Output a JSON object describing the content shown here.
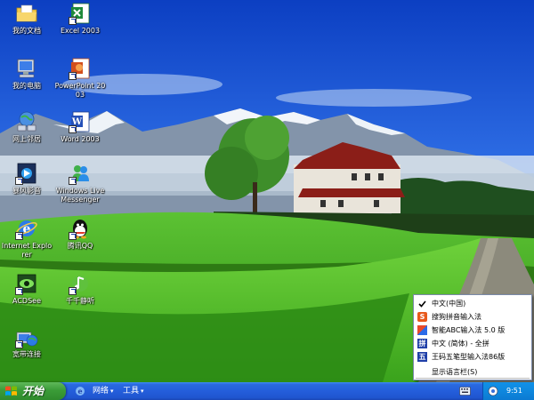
{
  "desktop_icons": [
    {
      "label": "我的文档",
      "icon": "my-documents-folder-icon"
    },
    {
      "label": "Excel 2003",
      "icon": "excel-icon"
    },
    {
      "label": "我的电脑",
      "icon": "my-computer-icon"
    },
    {
      "label": "PowerPoint 2003",
      "icon": "powerpoint-icon"
    },
    {
      "label": "网上邻居",
      "icon": "network-places-icon"
    },
    {
      "label": "Word 2003",
      "icon": "word-icon"
    },
    {
      "label": "暴风影音",
      "icon": "storm-player-icon"
    },
    {
      "label": "Windows Live Messenger",
      "icon": "messenger-icon"
    },
    {
      "label": "Internet Explorer",
      "icon": "internet-explorer-icon"
    },
    {
      "label": "腾讯QQ",
      "icon": "qq-icon"
    },
    {
      "label": "ACDSee",
      "icon": "acdsee-icon"
    },
    {
      "label": "千千静听",
      "icon": "ttplayer-icon"
    },
    {
      "label": "宽带连接",
      "icon": "broadband-connection-icon"
    }
  ],
  "language_menu": {
    "items": [
      {
        "label": "中文(中国)",
        "icon": "checkmark-icon"
      },
      {
        "label": "搜狗拼音输入法",
        "icon": "sogou-pinyin-icon"
      },
      {
        "label": "智能ABC输入法 5.0 版",
        "icon": "abc-ime-icon"
      },
      {
        "label": "中文 (简体) - 全拼",
        "icon": "quanpin-ime-icon"
      },
      {
        "label": "王码五笔型输入法86版",
        "icon": "wubi-ime-icon"
      },
      {
        "label": "显示语言栏(S)",
        "icon": ""
      }
    ]
  },
  "taskbar": {
    "start_label": "开始",
    "toolbar_network": "网络",
    "toolbar_tools": "工具",
    "clock": "9:51"
  },
  "colors": {
    "taskbar_blue": "#245edb",
    "start_green": "#3b9c38",
    "tray_blue": "#0f8ae0",
    "label_white": "#ffffff"
  }
}
